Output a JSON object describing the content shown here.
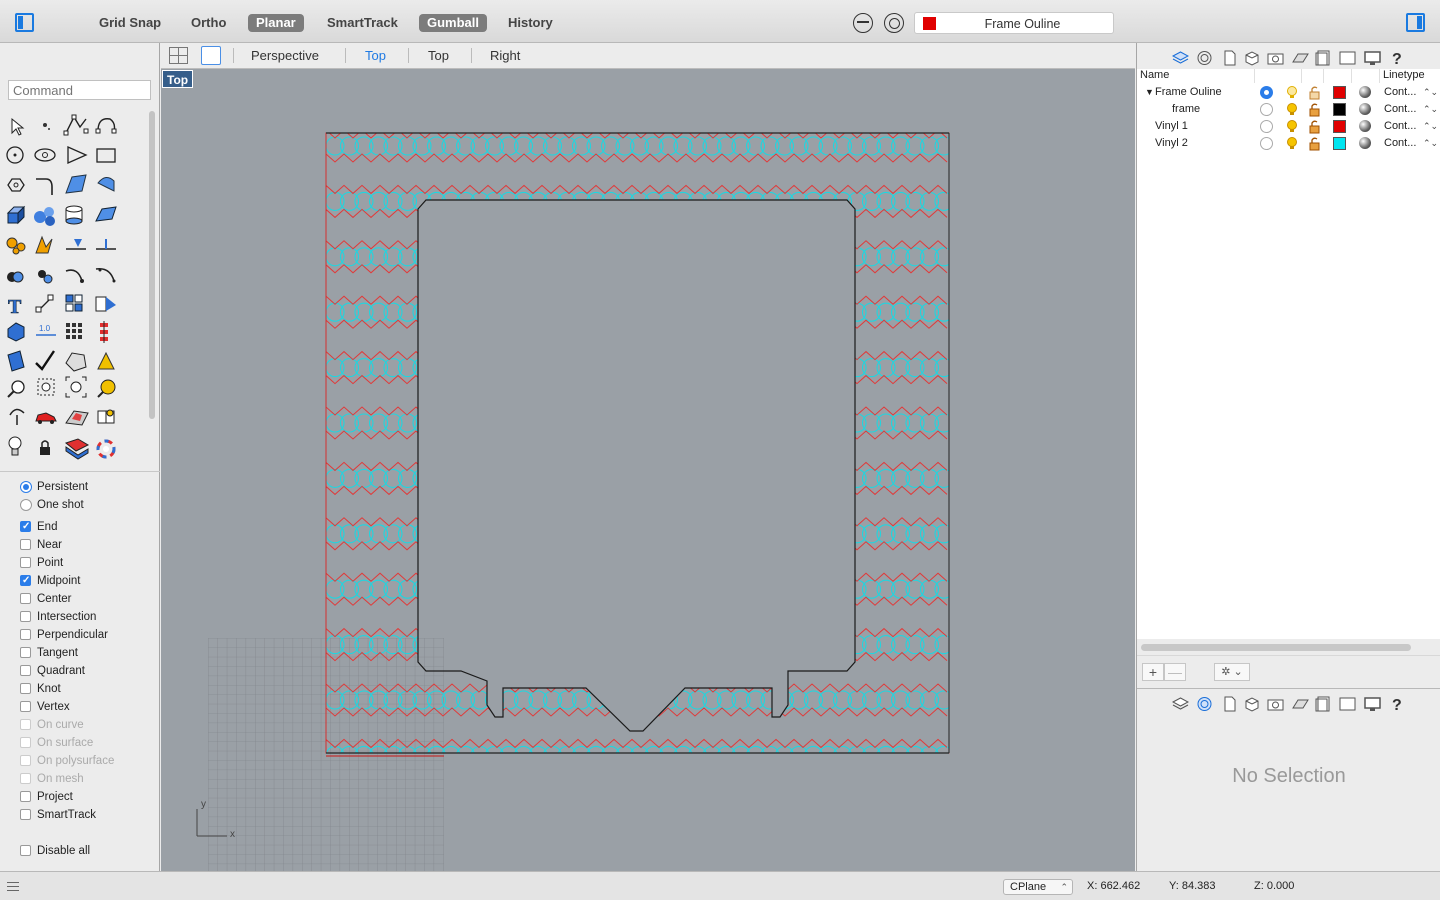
{
  "toolbar": {
    "buttons": [
      {
        "label": "Grid Snap",
        "active": false
      },
      {
        "label": "Ortho",
        "active": false
      },
      {
        "label": "Planar",
        "active": true
      },
      {
        "label": "SmartTrack",
        "active": false
      },
      {
        "label": "Gumball",
        "active": true
      },
      {
        "label": "History",
        "active": false
      }
    ],
    "current_layer": "Frame Ouline",
    "current_layer_color": "#e00000"
  },
  "command": {
    "placeholder": "Command"
  },
  "osnap": {
    "modes": [
      {
        "label": "Persistent",
        "selected": true
      },
      {
        "label": "One shot",
        "selected": false
      }
    ],
    "snaps": [
      {
        "label": "End",
        "checked": true,
        "enabled": true
      },
      {
        "label": "Near",
        "checked": false,
        "enabled": true
      },
      {
        "label": "Point",
        "checked": false,
        "enabled": true
      },
      {
        "label": "Midpoint",
        "checked": true,
        "enabled": true
      },
      {
        "label": "Center",
        "checked": false,
        "enabled": true
      },
      {
        "label": "Intersection",
        "checked": false,
        "enabled": true
      },
      {
        "label": "Perpendicular",
        "checked": false,
        "enabled": true
      },
      {
        "label": "Tangent",
        "checked": false,
        "enabled": true
      },
      {
        "label": "Quadrant",
        "checked": false,
        "enabled": true
      },
      {
        "label": "Knot",
        "checked": false,
        "enabled": true
      },
      {
        "label": "Vertex",
        "checked": false,
        "enabled": true
      },
      {
        "label": "On curve",
        "checked": false,
        "enabled": false
      },
      {
        "label": "On surface",
        "checked": false,
        "enabled": false
      },
      {
        "label": "On polysurface",
        "checked": false,
        "enabled": false
      },
      {
        "label": "On mesh",
        "checked": false,
        "enabled": false
      },
      {
        "label": "Project",
        "checked": false,
        "enabled": true
      },
      {
        "label": "SmartTrack",
        "checked": false,
        "enabled": true
      }
    ],
    "disable_all": "Disable all"
  },
  "viewport_tabs": [
    {
      "label": "Perspective",
      "active": false
    },
    {
      "label": "Top",
      "active": true
    },
    {
      "label": "Top",
      "active": false
    },
    {
      "label": "Right",
      "active": false
    }
  ],
  "viewport": {
    "label": "Top",
    "axis_x": "x",
    "axis_y": "y"
  },
  "layers": {
    "columns": {
      "name": "Name",
      "linetype": "Linetype"
    },
    "rows": [
      {
        "name": "Frame Ouline",
        "current": true,
        "color": "#e00000",
        "linetype": "Cont...",
        "expanded": true
      },
      {
        "name": "frame",
        "current": false,
        "color": "#000000",
        "linetype": "Cont..."
      },
      {
        "name": "Vinyl 1",
        "current": false,
        "color": "#e00000",
        "linetype": "Cont..."
      },
      {
        "name": "Vinyl 2",
        "current": false,
        "color": "#00e5f0",
        "linetype": "Cont..."
      }
    ],
    "add_label": "+",
    "remove_label": "—"
  },
  "properties": {
    "empty_text": "No Selection"
  },
  "statusbar": {
    "cplane": "CPlane",
    "x": "X: 662.462",
    "y": "Y: 84.383",
    "z": "Z: 0.000"
  }
}
